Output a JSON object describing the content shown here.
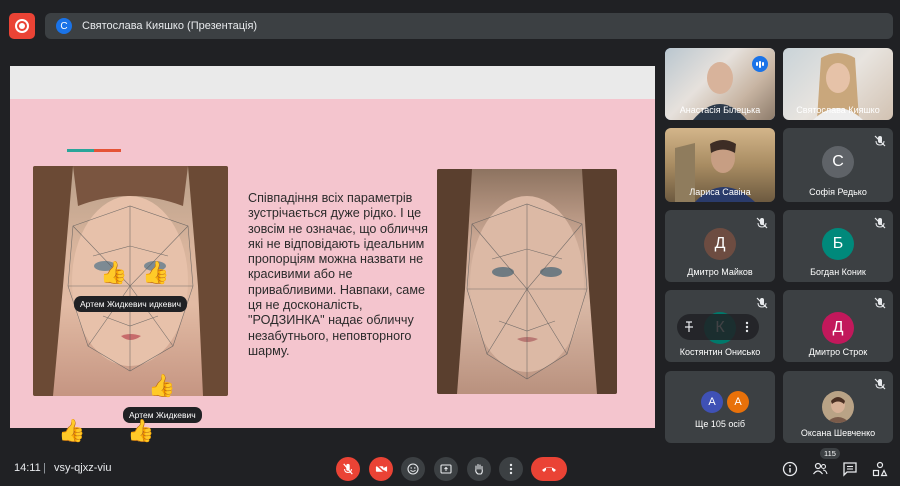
{
  "presentation": {
    "avatar_letter": "С",
    "title": "Святослава Кияшко (Презентація)"
  },
  "slide": {
    "text": "Співпадіння всіх параметрів зустрічається дуже рідко. І це зовсім не означає, що обличчя які не відповідають ідеальним пропорціям можна назвати не красивими або не привабливими. Навпаки, саме ця не досконаліcть, \"РОДЗИНКА\" надає обличчу незабутнього, неповторного шарму."
  },
  "reactions": {
    "chip1": "Артем Жидкевич  идкевич",
    "chip2": "Артем Жидкевич",
    "emoji": "👍"
  },
  "participants": [
    {
      "name": "Анастасія Білецька",
      "type": "video",
      "speaking": true
    },
    {
      "name": "Святослава Кияшко",
      "type": "video"
    },
    {
      "name": "Лариса Савіна",
      "type": "video"
    },
    {
      "name": "Софія Редько",
      "type": "avatar",
      "letter": "С",
      "color": "#5f6368",
      "muted": true
    },
    {
      "name": "Дмитро Майков",
      "type": "avatar",
      "letter": "Д",
      "color": "#6d4c41",
      "muted": true
    },
    {
      "name": "Богдан Коник",
      "type": "avatar",
      "letter": "Б",
      "color": "#00897b",
      "muted": true
    },
    {
      "name": "Костянтин Онисько",
      "type": "avatar",
      "letter": "К",
      "color": "#00796b",
      "muted": true
    },
    {
      "name": "Дмитро Строк",
      "type": "avatar",
      "letter": "Д",
      "color": "#c2185b",
      "muted": true
    },
    {
      "name": "Ще 105 осіб",
      "type": "more",
      "letters": [
        "А",
        "А"
      ],
      "colors": [
        "#3f51b5",
        "#e8710a"
      ]
    },
    {
      "name": "Оксана Шевченко",
      "type": "video-small",
      "muted": true
    }
  ],
  "bottom": {
    "time": "14:11",
    "separator": "|",
    "meeting_code": "vsy-qjxz-viu",
    "participant_count": "115"
  },
  "colors": {
    "background": "#202124",
    "tile": "#3c4043",
    "danger": "#ea4335",
    "accent": "#1a73e8"
  }
}
